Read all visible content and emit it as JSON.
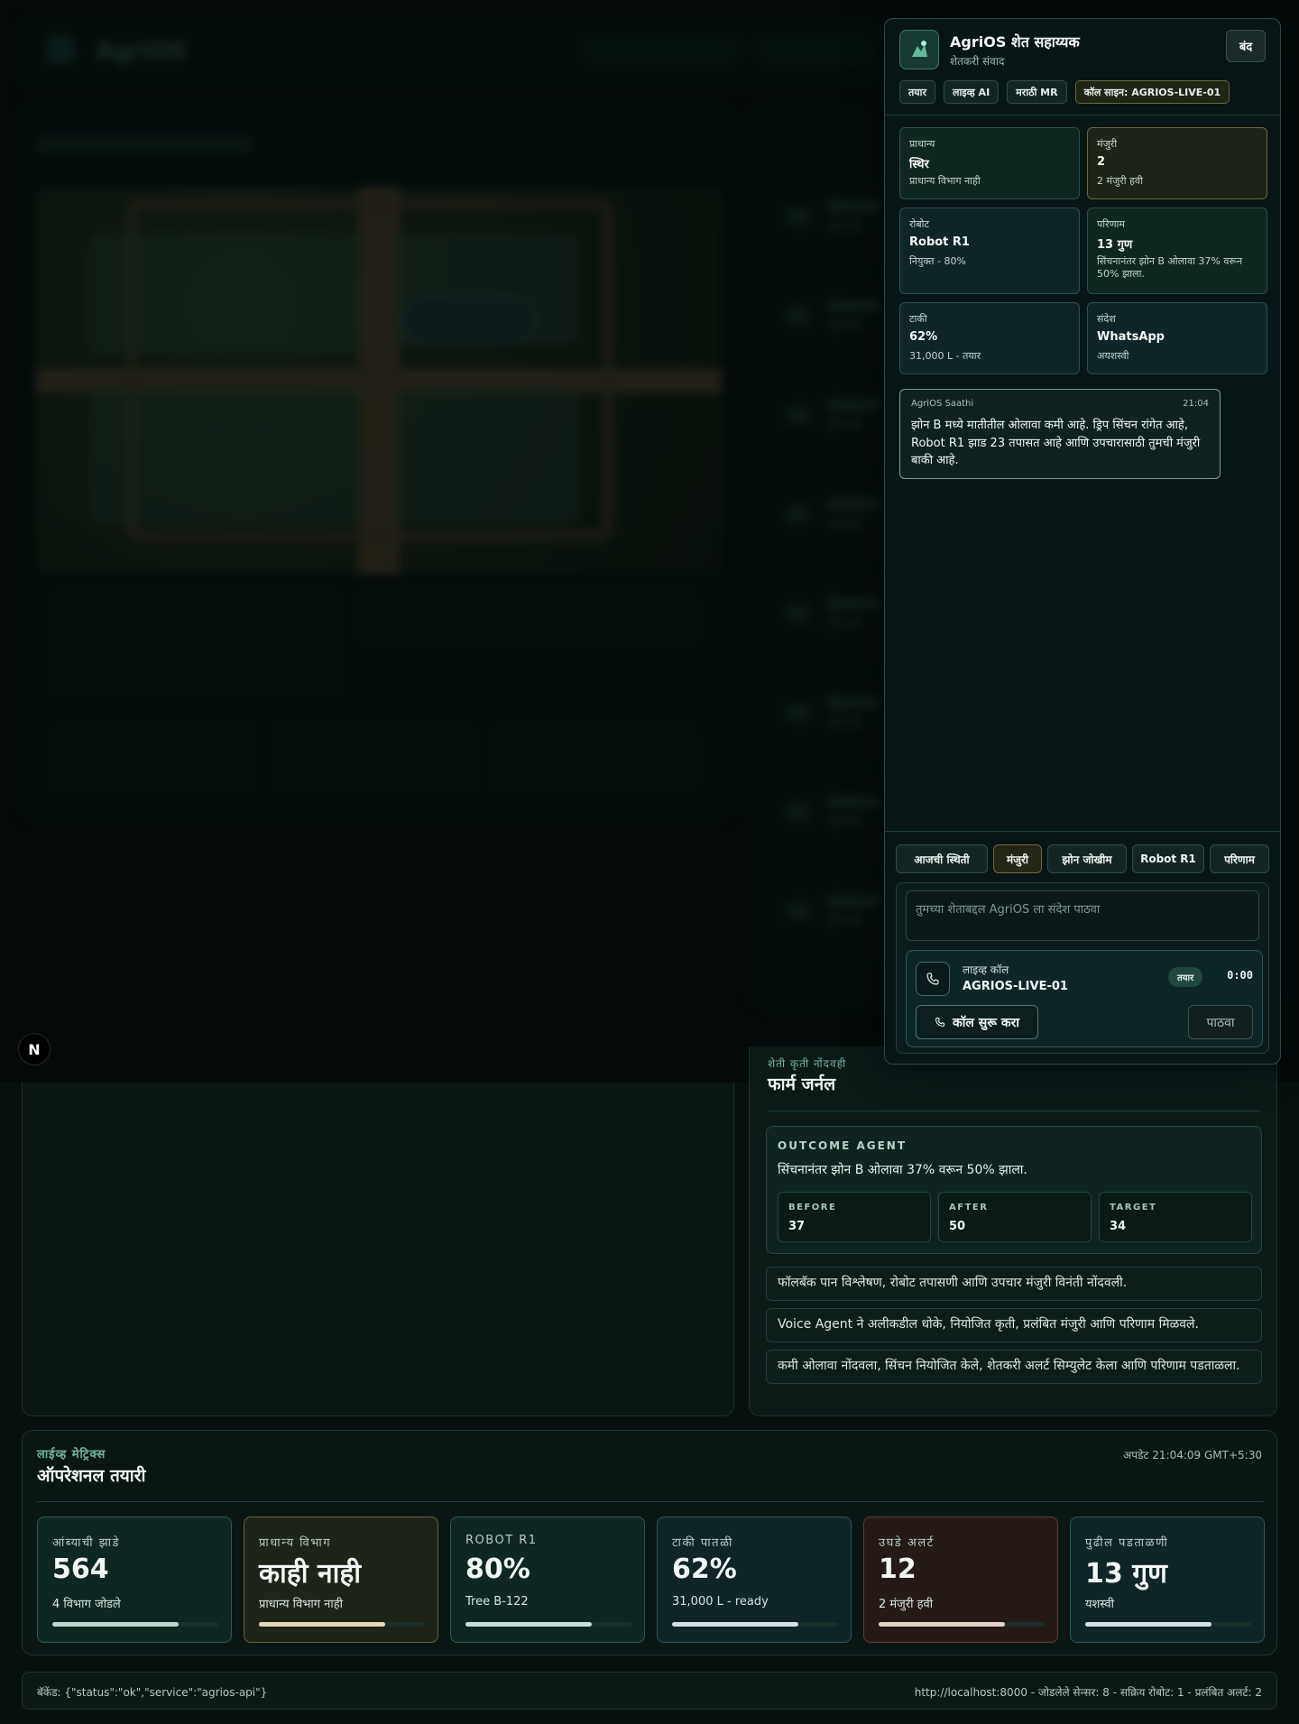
{
  "assistant": {
    "title": "AgriOS शेत सहाय्यक",
    "subtitle": "शेतकरी संवाद",
    "close_label": "बंद",
    "tags": [
      "तयार",
      "लाइव्ह AI",
      "मराठी MR",
      "कॉल साइन: AGRIOS-LIVE-01"
    ],
    "tiles": {
      "priority": {
        "label": "प्राधान्य",
        "value": "स्थिर",
        "sub": "प्राधान्य विभाग नाही"
      },
      "approval": {
        "label": "मंजुरी",
        "value": "2",
        "sub": "2 मंजुरी हवी"
      },
      "robot": {
        "label": "रोबोट",
        "value": "Robot R1",
        "sub": "नियुक्त - 80%"
      },
      "outcome": {
        "label": "परिणाम",
        "value": "13 गुण",
        "sub": "सिंचनानंतर झोन B ओलावा 37% वरून 50% झाला."
      },
      "tank": {
        "label": "टाकी",
        "value": "62%",
        "sub": "31,000 L - तयार"
      },
      "message": {
        "label": "संदेश",
        "value": "WhatsApp",
        "sub": "अयशस्वी"
      }
    },
    "chat": {
      "sender": "AgriOS Saathi",
      "time": "21:04",
      "text": "झोन B मध्ये मातीतील ओलावा कमी आहे. ड्रिप सिंचन रांगेत आहे, Robot R1 झाड 23 तपासत आहे आणि उपचारासाठी तुमची मंजुरी बाकी आहे."
    },
    "quick_actions": [
      "आजची स्थिती",
      "मंजुरी",
      "झोन जोखीम",
      "Robot R1",
      "परिणाम"
    ],
    "input_placeholder": "तुमच्या शेताबद्दल AgriOS ला संदेश पाठवा",
    "call": {
      "label": "लाइव्ह कॉल",
      "sign": "AGRIOS-LIVE-01",
      "status": "तयार",
      "timer": "0:00",
      "start_label": "कॉल सुरू करा",
      "send_label": "पाठवा"
    }
  },
  "journal": {
    "eyebrow": "शेती कृती नोंदवही",
    "title": "फार्म जर्नल",
    "outcome_label": "OUTCOME AGENT",
    "outcome_text": "सिंचनानंतर झोन B ओलावा 37% वरून 50% झाला.",
    "metrics": [
      {
        "label": "BEFORE",
        "value": "37"
      },
      {
        "label": "AFTER",
        "value": "50"
      },
      {
        "label": "TARGET",
        "value": "34"
      }
    ],
    "entries": [
      "फॉलबॅक पान विश्लेषण, रोबोट तपासणी आणि उपचार मंजुरी विनंती नोंदवली.",
      "Voice Agent ने अलीकडील धोके, नियोजित कृती, प्रलंबित मंजुरी आणि परिणाम मिळवले.",
      "कमी ओलावा नोंदवला, सिंचन नियोजित केले, शेतकरी अलर्ट सिम्युलेट केला आणि परिणाम पडताळला."
    ]
  },
  "metrics": {
    "eyebrow": "लाईव्ह मेट्रिक्स",
    "title": "ऑपरेशनल तयारी",
    "updated": "अपडेट 21:04:09 GMT+5:30",
    "cards": [
      {
        "label": "आंब्याची झाडे",
        "value": "564",
        "sub": "4 विभाग जोडले",
        "level": 0.76,
        "bg": "#0f2722",
        "border": "#2c5a4c",
        "fill": "#b8d8cb"
      },
      {
        "label": "प्राधान्य विभाग",
        "value": "काही नाही",
        "sub": "प्राधान्य विभाग नाही",
        "level": 0.76,
        "bg": "#1e2418",
        "border": "#6a643c",
        "fill": "#e5d7b8"
      },
      {
        "label": "ROBOT R1",
        "value": "80%",
        "sub": "Tree B-122",
        "level": 0.76,
        "bg": "#0f2722",
        "border": "#2c5a4c",
        "fill": "#c9ded6"
      },
      {
        "label": "टाकी पातळी",
        "value": "62%",
        "sub": "31,000 L - ready",
        "level": 0.76,
        "bg": "#0f2528",
        "border": "#2c5559",
        "fill": "#d3e2e1"
      },
      {
        "label": "उघडे अलर्ट",
        "value": "12",
        "sub": "2 मंजुरी हवी",
        "level": 0.76,
        "bg": "#261a17",
        "border": "#5e3a33",
        "fill": "#e2d2c6"
      },
      {
        "label": "पुढील पडताळणी",
        "value": "13 गुण",
        "sub": "यशस्वी",
        "level": 0.76,
        "bg": "#0f2528",
        "border": "#2c5559",
        "fill": "#d3e2e1"
      }
    ]
  },
  "footer": {
    "backend": "बॅकेंड: {\"status\":\"ok\",\"service\":\"agrios-api\"}",
    "info": "http://localhost:8000 - जोडलेले सेन्सर: 8 - सक्रिय रोबोट: 1 - प्रलंबित अलर्ट: 2"
  },
  "badge": "N"
}
